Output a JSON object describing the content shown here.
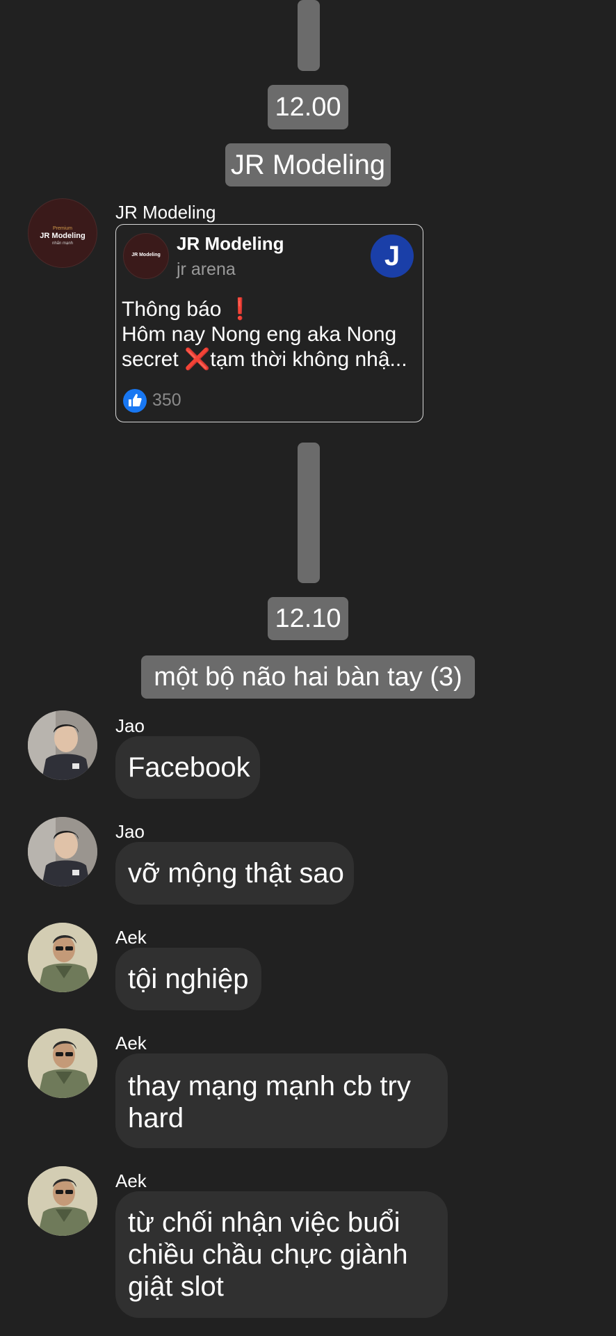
{
  "timeline": {
    "time_1": "12.00",
    "group_1": "JR Modeling",
    "time_2": "12.10",
    "group_2": "một bộ não hai bàn tay (3)"
  },
  "share": {
    "sender": "JR Modeling",
    "avatar_text_top": "Premium",
    "avatar_text_main": "JR Modeling",
    "avatar_text_bottom": "nhấn mạnh",
    "card_title": "JR Modeling",
    "card_subtitle": "jr arena",
    "badge_letter": "J",
    "body_line1": "Thông báo ❗",
    "body_line2": "Hôm nay Nong eng aka Nong",
    "body_line3": "secret ❌tạm thời không nhậ...",
    "like_count": "350"
  },
  "messages": [
    {
      "sender": "Jao",
      "text": "Facebook"
    },
    {
      "sender": "Jao",
      "text": "vỡ mộng thật sao"
    },
    {
      "sender": "Aek",
      "text": "tội nghiệp"
    },
    {
      "sender": "Aek",
      "text": "thay mạng mạnh cb try hard"
    },
    {
      "sender": "Aek",
      "text": "từ chối nhận việc buổi chiều chầu chực giành giật slot"
    }
  ],
  "colors": {
    "background": "#212121",
    "bubble": "#303030",
    "pill": "#6b6b6b",
    "like_blue": "#1877f2",
    "badge_blue": "#1a3fa8"
  }
}
